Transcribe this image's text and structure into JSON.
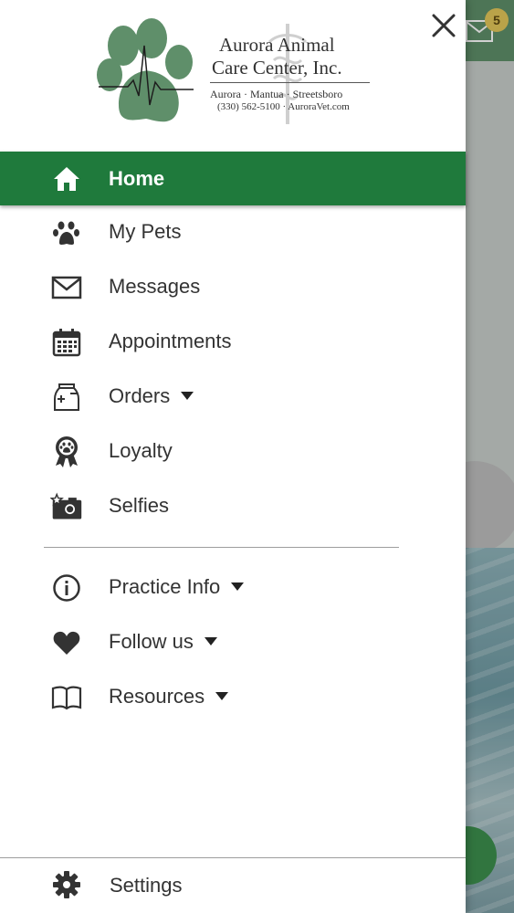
{
  "practice": {
    "name_line1": "Aurora Animal",
    "name_line2": "Care Center, Inc.",
    "towns": "Aurora · Mantua · Streetsboro",
    "contact": "(330) 562-5100 · AuroraVet.com"
  },
  "header": {
    "message_badge": "5"
  },
  "menu": {
    "home": "Home",
    "my_pets": "My Pets",
    "messages": "Messages",
    "appointments": "Appointments",
    "orders": "Orders",
    "loyalty": "Loyalty",
    "selfies": "Selfies",
    "practice_info": "Practice Info",
    "follow_us": "Follow us",
    "resources": "Resources",
    "settings": "Settings"
  },
  "colors": {
    "active_bg": "#1f7a3c",
    "topbar": "#5f8f6a",
    "badge": "#e3c75a",
    "text": "#333333"
  },
  "icons": {
    "close": "close-icon",
    "home": "home-icon",
    "pets": "paw-icon",
    "messages": "envelope-icon",
    "appointments": "calendar-icon",
    "orders": "medicine-bag-icon",
    "loyalty": "award-ribbon-icon",
    "selfies": "camera-star-icon",
    "practice_info": "info-icon",
    "follow_us": "heart-icon",
    "resources": "book-icon",
    "settings": "gear-icon"
  }
}
